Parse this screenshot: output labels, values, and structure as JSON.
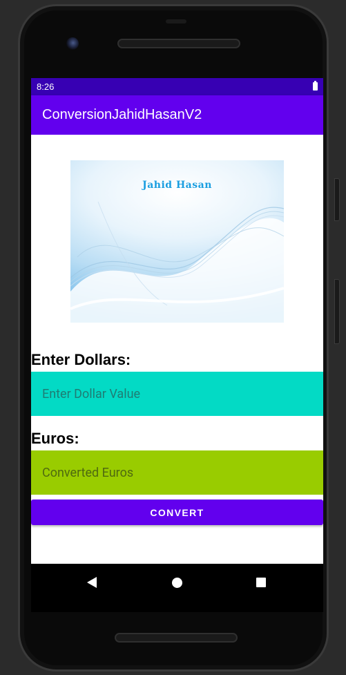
{
  "status_bar": {
    "time": "8:26"
  },
  "app_bar": {
    "title": "ConversionJahidHasanV2"
  },
  "banner": {
    "text": "Jahid Hasan"
  },
  "dollars": {
    "label": "Enter Dollars:",
    "placeholder": "Enter Dollar Value",
    "value": ""
  },
  "euros": {
    "label": "Euros:",
    "placeholder": "Converted Euros",
    "value": ""
  },
  "convert_button": {
    "label": "CONVERT"
  },
  "colors": {
    "status_bar": "#3700b3",
    "app_bar": "#6200ee",
    "dollar_field": "#03dac5",
    "euro_field": "#99cc00",
    "button": "#6200ee"
  },
  "nav_icons": [
    "back-icon",
    "home-icon",
    "recents-icon"
  ]
}
